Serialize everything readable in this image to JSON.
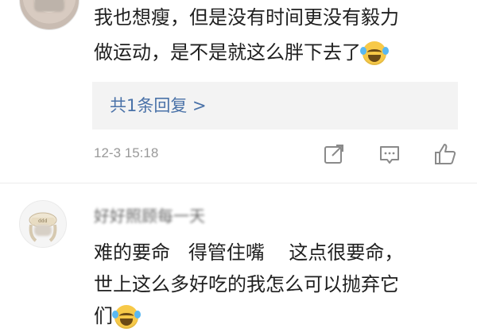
{
  "comment1": {
    "text_line1": "我也想瘦，但是没有时间更没有毅力",
    "text_line2": "做运动，是不是就这么胖下去了",
    "reply_link": "共1条回复 >",
    "timestamp": "12-3 15:18"
  },
  "comment2": {
    "username": "好好照顾每一天",
    "text_line1": "难的要命   得管住嘴    这点很要命，",
    "text_line2": "世上这么多好吃的我怎么可以抛弃它",
    "text_line3": "们"
  },
  "colors": {
    "link": "#4a72a8",
    "meta": "#999999",
    "reply_bg": "#f3f3f3"
  },
  "icons": {
    "share": "share-icon",
    "comment": "comment-icon",
    "like": "thumbs-up-icon",
    "emoji": "laughing-crying-emoji"
  }
}
